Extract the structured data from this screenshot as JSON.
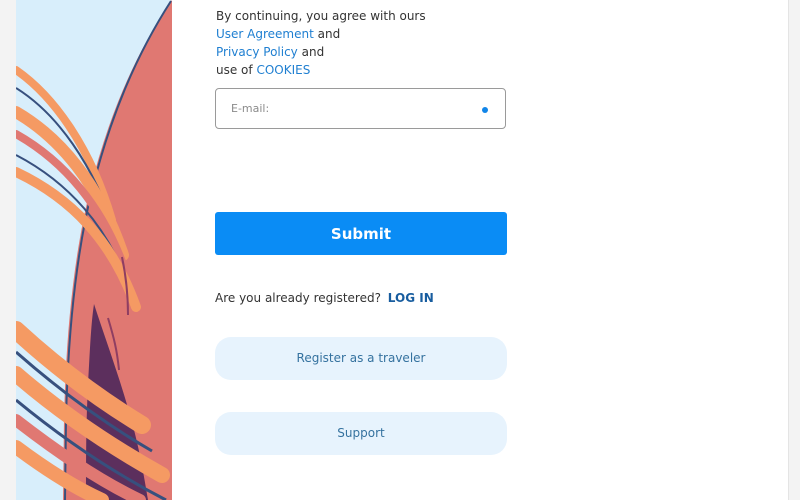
{
  "consent": {
    "line1_text": "By continuing, you agree with ours",
    "agreement_link": "User Agreement",
    "and_1": "and",
    "privacy_link": "Privacy Policy",
    "and_2": "and",
    "use_of": "use of",
    "cookies_link": "COOKIES"
  },
  "form": {
    "email_placeholder": "E-mail:",
    "submit_label": "Submit"
  },
  "login": {
    "question": "Are you already registered?",
    "link_label": "LOG IN"
  },
  "actions": {
    "register_label": "Register as a traveler",
    "support_label": "Support"
  },
  "theme": {
    "accent": "#0a8cf5",
    "link_blue": "#1f7fd1",
    "dark_link_blue": "#185d9f",
    "soft_button": "#e7f3fd",
    "art_sky": "#d8eefb",
    "art_coral": "#e07872",
    "art_orange": "#f59a63",
    "art_purple": "#5c2f5d",
    "art_navy": "#37507e"
  }
}
